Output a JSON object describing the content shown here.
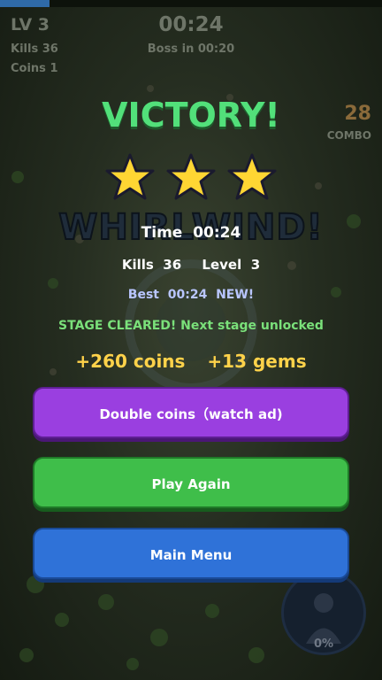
{
  "hud": {
    "level": "LV 3",
    "kills": "Kills 36",
    "coins": "Coins 1",
    "timer": "00:24",
    "boss": "Boss in 00:20",
    "combo_count": "28",
    "combo_label": "COMBO",
    "xp_progress": 0.13
  },
  "banner": "WHIRLWIND!",
  "portrait_percent": "0%",
  "result": {
    "title": "VICTORY!",
    "stars": 3,
    "time_label": "Time",
    "time_value": "00:24",
    "kills_label": "Kills",
    "kills_value": "36",
    "level_label": "Level",
    "level_value": "3",
    "best_label": "Best",
    "best_value": "00:24",
    "best_badge": "NEW!",
    "stage_message": "STAGE CLEARED! Next stage unlocked",
    "coins_reward": "+260 coins",
    "gems_reward": "+13 gems"
  },
  "buttons": {
    "double": "Double coins（watch ad)",
    "play_again": "Play Again",
    "main_menu": "Main Menu"
  },
  "colors": {
    "victory": "#52e07a",
    "star": "#ffd633",
    "reward": "#ffd24a",
    "double_button": "#9a3fe0",
    "play_button": "#3fbe4a",
    "menu_button": "#2f72d8"
  }
}
